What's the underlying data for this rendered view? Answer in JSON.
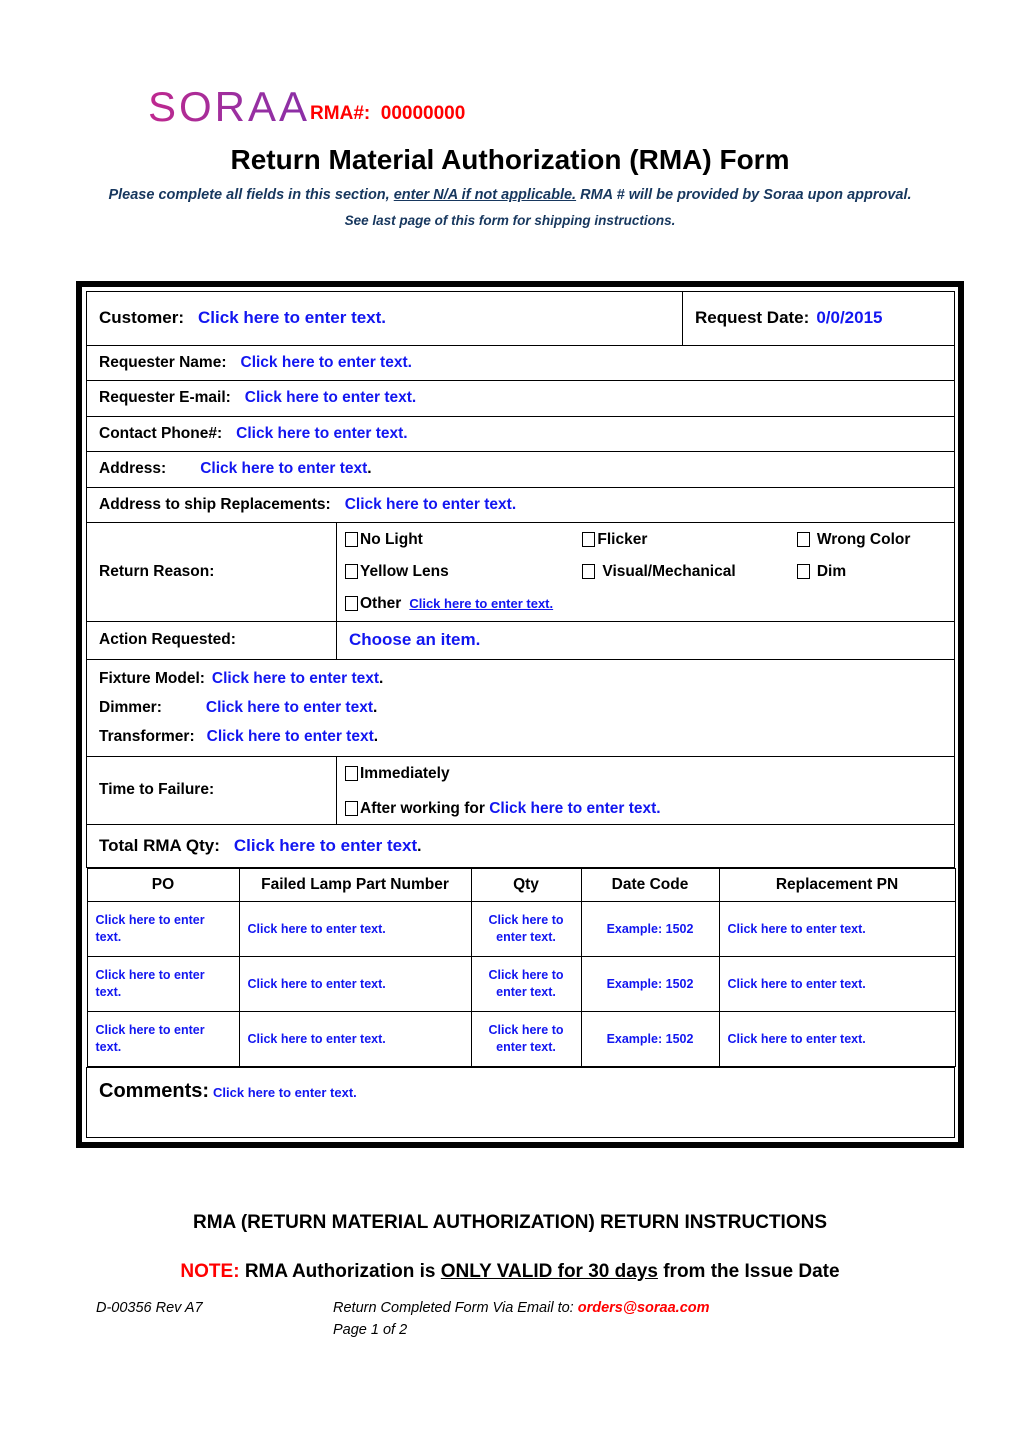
{
  "header": {
    "logo_text": "SORAA",
    "rma_label": "RMA#:",
    "rma_number": "00000000",
    "title": "Return Material Authorization (RMA) Form",
    "subtitle_a": "Please complete all fields in this section,",
    "subtitle_b": "enter N/A if not applicable.",
    "subtitle_c": "RMA # will be provided by Soraa upon approval.",
    "subtitle2": "See last page of this form for shipping instructions."
  },
  "form": {
    "customer_label": "Customer:",
    "customer_value": "Click here to enter text.",
    "request_date_label": "Request Date:",
    "request_date_value": "0/0/2015",
    "requester_name_label": "Requester Name:",
    "requester_name_value": "Click here to enter text.",
    "requester_email_label": "Requester E-mail:",
    "requester_email_value": "Click here to enter text.",
    "contact_phone_label": "Contact Phone#:",
    "contact_phone_value": "Click here to enter text.",
    "address_label": "Address:",
    "address_value": "Click here to enter text",
    "address_value_dot": ".",
    "ship_address_label": "Address to ship Replacements:",
    "ship_address_value": "Click here to enter text.",
    "return_reason_label": "Return Reason:",
    "reasons": [
      "No Light",
      "Flicker",
      "Wrong Color",
      "Yellow Lens",
      "Visual/Mechanical",
      "Dim"
    ],
    "other_label": "Other",
    "other_value": "Click here to enter text.",
    "action_requested_label": "Action Requested:",
    "action_requested_value": "Choose an item.",
    "fixture_model_label": "Fixture Model:",
    "fixture_model_value": "Click here to enter text",
    "dimmer_label": "Dimmer:",
    "dimmer_value": "Click here to enter text",
    "transformer_label": "Transformer:",
    "transformer_value": "Click here to enter text",
    "dot": ".",
    "time_to_failure_label": "Time to Failure:",
    "immediately_label": "Immediately",
    "after_working_label": "After working for",
    "after_working_value": "Click here to enter text.",
    "total_qty_label": "Total RMA Qty:",
    "total_qty_value": "Click here to enter text",
    "comments_label": "Comments:",
    "comments_value": "Click here to enter text."
  },
  "table": {
    "columns": [
      "PO",
      "Failed Lamp Part Number",
      "Qty",
      "Date Code",
      "Replacement PN"
    ],
    "rows": [
      {
        "po": "Click here to enter text.",
        "part_number": "Click here to enter text.",
        "qty": "Click here to enter text.",
        "date_code": "Example: 1502",
        "replacement_pn": "Click here to enter text."
      },
      {
        "po": "Click here to enter text.",
        "part_number": "Click here to enter text.",
        "qty": "Click here to enter text.",
        "date_code": "Example: 1502",
        "replacement_pn": "Click here to enter text."
      },
      {
        "po": "Click here to enter text.",
        "part_number": "Click here to enter text.",
        "qty": "Click here to enter text.",
        "date_code": "Example: 1502",
        "replacement_pn": "Click here to enter text."
      }
    ]
  },
  "footer": {
    "instructions_title": "RMA (RETURN MATERIAL AUTHORIZATION) RETURN INSTRUCTIONS",
    "note_prefix": "NOTE:",
    "note_a": "RMA Authorization is",
    "note_underlined": "ONLY VALID for 30 days",
    "note_b": "from the Issue Date",
    "doc_id": "D-00356 Rev A7",
    "email_prefix": "Return Completed Form Via Email to:",
    "email": "orders@soraa.com",
    "page": "Page 1 of 2"
  },
  "colors": {
    "field_value": "#1216f0",
    "accent_red": "#ff0000",
    "logo_start": "#c0288f",
    "logo_end": "#8a2fa6",
    "subtitle_navy": "#17375e"
  }
}
